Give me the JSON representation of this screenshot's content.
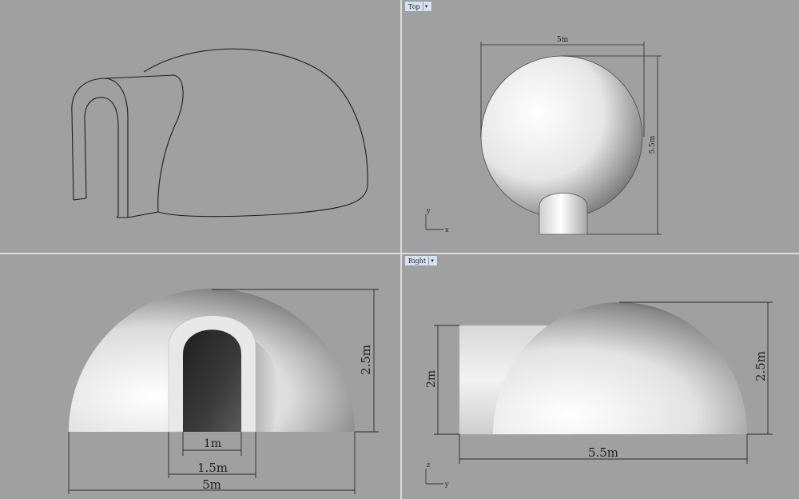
{
  "viewports": {
    "top": {
      "label": "Top",
      "dim_width": "5m",
      "dim_height": "5.5m",
      "axis_x": "x",
      "axis_y": "y"
    },
    "front": {
      "dim_door_inner": "1m",
      "dim_door_outer": "1.5m",
      "dim_width": "5m",
      "dim_height": "2.5m"
    },
    "right": {
      "label": "Right",
      "dim_tunnel_height": "2m",
      "dim_height": "2.5m",
      "dim_length": "5.5m",
      "axis_h": "y",
      "axis_v": "z"
    }
  },
  "colors": {
    "viewport_bg": "#a0a0a0",
    "divider": "#dcdcdc",
    "dimension_line": "#2a2a2a",
    "tab_bg": "#d8e2ef"
  },
  "icons": {
    "tab_caret": "chevron-down-icon"
  }
}
